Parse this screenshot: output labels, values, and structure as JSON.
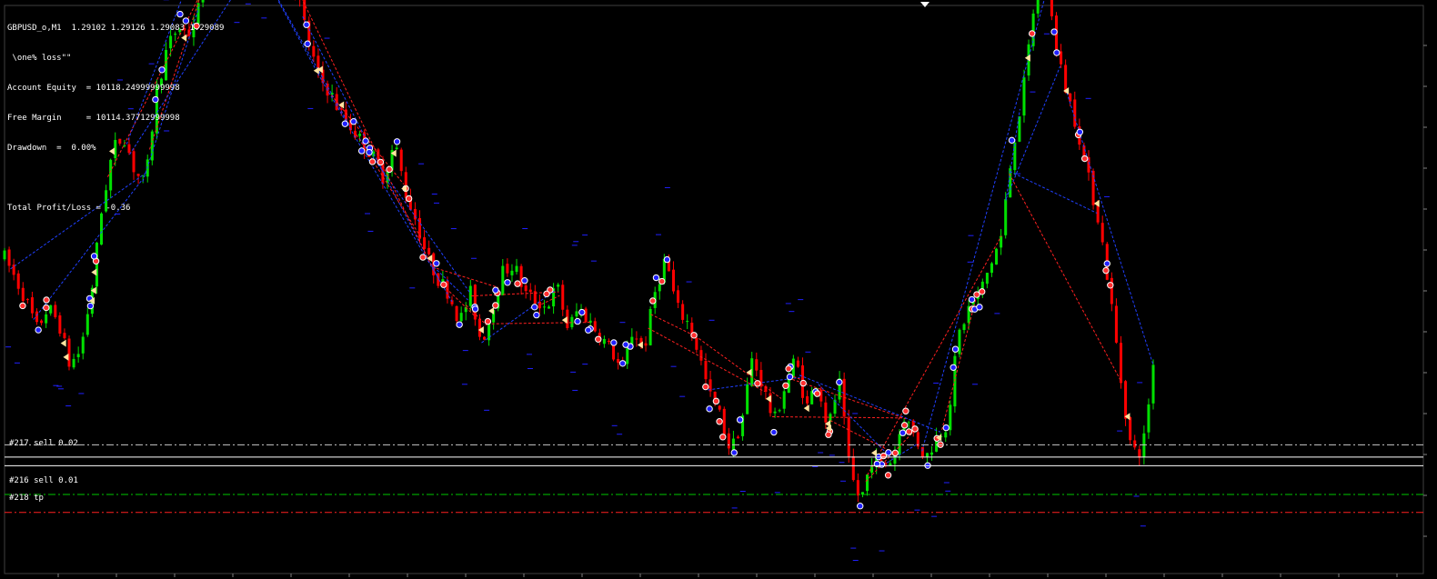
{
  "header": {
    "symbol_line": "GBPUSD_o,M1  1.29102 1.29126 1.29083 1.29089",
    "ea_name": " \\one% loss\"\"",
    "equity_line": "Account Equity  = 10118.24999999998",
    "margin_line": "Free Margin     = 10114.37712999998",
    "drawdown_line": "Drawdown  =  0.00%",
    "profit_line": "Total Profit/Loss = -0.36"
  },
  "orders": [
    {
      "label": "#217 sell 0.02",
      "price": 1.29089,
      "color": "#c8c8c8",
      "style": "dashdot"
    },
    {
      "label": "",
      "price": 1.29072,
      "color": "#ffffff",
      "style": "solid"
    },
    {
      "label": "",
      "price": 1.2906,
      "color": "#ffffff",
      "style": "solid"
    },
    {
      "label": "#216 sell 0.01",
      "price": 1.2902,
      "color": "#00c800",
      "style": "dashdot"
    },
    {
      "label": "#218 tp",
      "price": 1.28995,
      "color": "#ff2020",
      "style": "dashdot"
    }
  ],
  "colors": {
    "background": "#000000",
    "bull": "#00e000",
    "bear": "#ff0000",
    "blue_marker": "#2020ff",
    "red_marker": "#ff3030",
    "blue_line": "#2040ff",
    "red_line": "#ff2020",
    "arrow": "#ffe4a0"
  },
  "chart_data": {
    "type": "candlestick",
    "symbol": "GBPUSD_o",
    "timeframe": "M1",
    "ohlc": {
      "open": 1.29102,
      "high": 1.29126,
      "low": 1.29083,
      "close": 1.29089
    },
    "price_range": [
      1.2891,
      1.297
    ],
    "close_profile": [
      [
        0,
        1.2935
      ],
      [
        0.5,
        1.2932
      ],
      [
        1,
        1.2929
      ],
      [
        1.5,
        1.2925
      ],
      [
        2,
        1.2928
      ],
      [
        2.5,
        1.2926
      ],
      [
        3,
        1.292
      ],
      [
        3.5,
        1.2922
      ],
      [
        4,
        1.293
      ],
      [
        4.5,
        1.2942
      ],
      [
        5,
        1.295
      ],
      [
        5.5,
        1.2952
      ],
      [
        6,
        1.2947
      ],
      [
        6.5,
        1.2945
      ],
      [
        7,
        1.2958
      ],
      [
        7.5,
        1.2964
      ],
      [
        8,
        1.2967
      ],
      [
        8.5,
        1.2966
      ],
      [
        9,
        1.297
      ],
      [
        9.5,
        1.2978
      ],
      [
        10,
        1.2987
      ],
      [
        10.5,
        1.2982
      ],
      [
        11,
        1.2975
      ],
      [
        11.5,
        1.2983
      ],
      [
        12,
        1.298
      ],
      [
        12.5,
        1.2974
      ],
      [
        13,
        1.2976
      ],
      [
        13.5,
        1.2972
      ],
      [
        14,
        1.2965
      ],
      [
        14.5,
        1.296
      ],
      [
        15,
        1.2958
      ],
      [
        15.5,
        1.2955
      ],
      [
        16,
        1.2953
      ],
      [
        16.5,
        1.2951
      ],
      [
        17,
        1.2949
      ],
      [
        17.5,
        1.2946
      ],
      [
        18,
        1.2951
      ],
      [
        18.5,
        1.2944
      ],
      [
        19,
        1.294
      ],
      [
        19.5,
        1.2935
      ],
      [
        20,
        1.2932
      ],
      [
        20.5,
        1.293
      ],
      [
        21,
        1.2926
      ],
      [
        21.5,
        1.293
      ],
      [
        22,
        1.2923
      ],
      [
        22.5,
        1.2928
      ],
      [
        23,
        1.2933
      ],
      [
        23.5,
        1.2934
      ],
      [
        24,
        1.293
      ],
      [
        24.5,
        1.2929
      ],
      [
        25,
        1.2928
      ],
      [
        25.5,
        1.2931
      ],
      [
        26,
        1.2925
      ],
      [
        26.5,
        1.2928
      ],
      [
        27,
        1.2926
      ],
      [
        27.5,
        1.2924
      ],
      [
        28,
        1.2922
      ],
      [
        28.5,
        1.2919
      ],
      [
        29,
        1.2925
      ],
      [
        29.5,
        1.2922
      ],
      [
        30,
        1.293
      ],
      [
        30.5,
        1.2935
      ],
      [
        31,
        1.2928
      ],
      [
        31.5,
        1.2926
      ],
      [
        32,
        1.2922
      ],
      [
        32.5,
        1.2916
      ],
      [
        33,
        1.2913
      ],
      [
        33.5,
        1.2908
      ],
      [
        34,
        1.2912
      ],
      [
        34.5,
        1.2921
      ],
      [
        35,
        1.2917
      ],
      [
        35.5,
        1.2912
      ],
      [
        36,
        1.2917
      ],
      [
        36.5,
        1.2921
      ],
      [
        37,
        1.2914
      ],
      [
        37.5,
        1.2918
      ],
      [
        38,
        1.2911
      ],
      [
        38.5,
        1.2918
      ],
      [
        39,
        1.2905
      ],
      [
        39.5,
        1.2901
      ],
      [
        40,
        1.2907
      ],
      [
        40.5,
        1.2906
      ],
      [
        41,
        1.2907
      ],
      [
        41.5,
        1.2913
      ],
      [
        42,
        1.291
      ],
      [
        42.5,
        1.2907
      ],
      [
        43,
        1.291
      ],
      [
        43.5,
        1.2912
      ],
      [
        44,
        1.2924
      ],
      [
        44.5,
        1.2928
      ],
      [
        45,
        1.293
      ],
      [
        45.5,
        1.2934
      ],
      [
        46,
        1.2938
      ],
      [
        46.5,
        1.295
      ],
      [
        47,
        1.2958
      ],
      [
        47.5,
        1.297
      ],
      [
        48,
        1.2978
      ],
      [
        48.5,
        1.2964
      ],
      [
        49,
        1.2958
      ],
      [
        49.5,
        1.2953
      ],
      [
        50,
        1.2946
      ],
      [
        50.5,
        1.294
      ],
      [
        51,
        1.293
      ],
      [
        51.5,
        1.2918
      ],
      [
        52,
        1.2908
      ],
      [
        52.5,
        1.2908
      ],
      [
        53,
        1.292
      ]
    ]
  }
}
